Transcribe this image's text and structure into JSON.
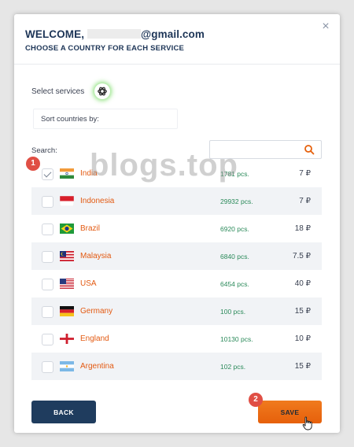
{
  "header": {
    "welcome_prefix": "WELCOME,",
    "email_suffix": "@gmail.com",
    "subtitle": "CHOOSE A COUNTRY FOR EACH SERVICE",
    "close_glyph": "×"
  },
  "services": {
    "label": "Select services",
    "selected_icon": "openai-icon"
  },
  "sort": {
    "label": "Sort countries by:"
  },
  "search": {
    "label": "Search:",
    "placeholder": ""
  },
  "countries": [
    {
      "name": "India",
      "count": "1781 pcs.",
      "price": "7 ₽",
      "checked": true,
      "flag": "india-flag"
    },
    {
      "name": "Indonesia",
      "count": "29932 pcs.",
      "price": "7 ₽",
      "checked": false,
      "flag": "indonesia-flag"
    },
    {
      "name": "Brazil",
      "count": "6920 pcs.",
      "price": "18 ₽",
      "checked": false,
      "flag": "brazil-flag"
    },
    {
      "name": "Malaysia",
      "count": "6840 pcs.",
      "price": "7.5 ₽",
      "checked": false,
      "flag": "malaysia-flag"
    },
    {
      "name": "USA",
      "count": "6454 pcs.",
      "price": "40 ₽",
      "checked": false,
      "flag": "usa-flag"
    },
    {
      "name": "Germany",
      "count": "100 pcs.",
      "price": "15 ₽",
      "checked": false,
      "flag": "germany-flag"
    },
    {
      "name": "England",
      "count": "10130 pcs.",
      "price": "10 ₽",
      "checked": false,
      "flag": "england-flag"
    },
    {
      "name": "Argentina",
      "count": "102 pcs.",
      "price": "15 ₽",
      "checked": false,
      "flag": "argentina-flag"
    }
  ],
  "footer": {
    "back_label": "BACK",
    "save_label": "SAVE"
  },
  "annotations": {
    "badge_1": "1",
    "badge_2": "2",
    "watermark": "blogs.top"
  },
  "colors": {
    "accent": "#e6600b",
    "navy": "#1f3c5e",
    "country_text": "#e35a12",
    "count_text": "#2b8a5a",
    "badge": "#e04f45"
  }
}
